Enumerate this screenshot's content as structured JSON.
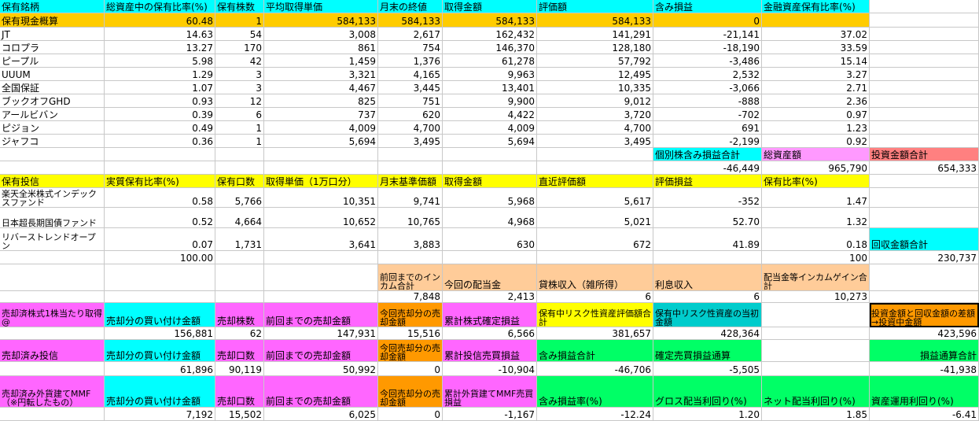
{
  "colors": {
    "cyan": "#00ffff",
    "yellow": "#ffff00",
    "orange": "#ff9900",
    "gold": "#ffcc00",
    "pink": "#ff66ff",
    "peach": "#ffcc99",
    "green": "#00ff66",
    "teal": "#00cccc",
    "lavender": "#ff99ff",
    "salmon": "#ff8080",
    "white": "#ffffff"
  },
  "cells": [
    {
      "r": 0,
      "c": 0,
      "t": "保有銘柄",
      "bg": "cyan",
      "a": "l"
    },
    {
      "r": 0,
      "c": 1,
      "t": "総資産中の保有比率(%)",
      "bg": "cyan",
      "a": "l"
    },
    {
      "r": 0,
      "c": 2,
      "t": "保有株数",
      "bg": "cyan",
      "a": "l"
    },
    {
      "r": 0,
      "c": 3,
      "t": "平均取得単価",
      "bg": "cyan",
      "a": "l"
    },
    {
      "r": 0,
      "c": 4,
      "t": "月末の終値",
      "bg": "cyan",
      "a": "l"
    },
    {
      "r": 0,
      "c": 5,
      "t": "取得金額",
      "bg": "cyan",
      "a": "l"
    },
    {
      "r": 0,
      "c": 6,
      "t": "評価額",
      "bg": "cyan",
      "a": "l"
    },
    {
      "r": 0,
      "c": 7,
      "t": "含み損益",
      "bg": "cyan",
      "a": "l"
    },
    {
      "r": 0,
      "c": 8,
      "t": "金融資産保有比率(%)",
      "bg": "cyan",
      "a": "l"
    },
    {
      "r": 1,
      "c": 0,
      "t": "保有現金概算",
      "bg": "gold",
      "a": "l"
    },
    {
      "r": 1,
      "c": 1,
      "t": "60.48",
      "bg": "gold",
      "a": "r"
    },
    {
      "r": 1,
      "c": 2,
      "t": "1",
      "bg": "gold",
      "a": "r"
    },
    {
      "r": 1,
      "c": 3,
      "t": "584,133",
      "bg": "gold",
      "a": "r"
    },
    {
      "r": 1,
      "c": 4,
      "t": "584,133",
      "bg": "gold",
      "a": "r"
    },
    {
      "r": 1,
      "c": 5,
      "t": "584,133",
      "bg": "gold",
      "a": "r"
    },
    {
      "r": 1,
      "c": 6,
      "t": "584,133",
      "bg": "gold",
      "a": "r"
    },
    {
      "r": 1,
      "c": 7,
      "t": "0",
      "bg": "gold",
      "a": "r"
    },
    {
      "r": 1,
      "c": 8,
      "t": "",
      "bg": "gold",
      "a": "r"
    },
    {
      "r": 2,
      "c": 0,
      "t": "JT",
      "a": "l"
    },
    {
      "r": 2,
      "c": 1,
      "t": "14.63",
      "a": "r"
    },
    {
      "r": 2,
      "c": 2,
      "t": "54",
      "a": "r"
    },
    {
      "r": 2,
      "c": 3,
      "t": "3,008",
      "a": "r"
    },
    {
      "r": 2,
      "c": 4,
      "t": "2,617",
      "a": "r"
    },
    {
      "r": 2,
      "c": 5,
      "t": "162,432",
      "a": "r"
    },
    {
      "r": 2,
      "c": 6,
      "t": "141,291",
      "a": "r"
    },
    {
      "r": 2,
      "c": 7,
      "t": "-21,141",
      "a": "r"
    },
    {
      "r": 2,
      "c": 8,
      "t": "37.02",
      "a": "r"
    },
    {
      "r": 3,
      "c": 0,
      "t": "コロプラ",
      "a": "l"
    },
    {
      "r": 3,
      "c": 1,
      "t": "13.27",
      "a": "r"
    },
    {
      "r": 3,
      "c": 2,
      "t": "170",
      "a": "r"
    },
    {
      "r": 3,
      "c": 3,
      "t": "861",
      "a": "r"
    },
    {
      "r": 3,
      "c": 4,
      "t": "754",
      "a": "r"
    },
    {
      "r": 3,
      "c": 5,
      "t": "146,370",
      "a": "r"
    },
    {
      "r": 3,
      "c": 6,
      "t": "128,180",
      "a": "r"
    },
    {
      "r": 3,
      "c": 7,
      "t": "-18,190",
      "a": "r"
    },
    {
      "r": 3,
      "c": 8,
      "t": "33.59",
      "a": "r"
    },
    {
      "r": 4,
      "c": 0,
      "t": "ピープル",
      "a": "l"
    },
    {
      "r": 4,
      "c": 1,
      "t": "5.98",
      "a": "r"
    },
    {
      "r": 4,
      "c": 2,
      "t": "42",
      "a": "r"
    },
    {
      "r": 4,
      "c": 3,
      "t": "1,459",
      "a": "r"
    },
    {
      "r": 4,
      "c": 4,
      "t": "1,376",
      "a": "r"
    },
    {
      "r": 4,
      "c": 5,
      "t": "61,278",
      "a": "r"
    },
    {
      "r": 4,
      "c": 6,
      "t": "57,792",
      "a": "r"
    },
    {
      "r": 4,
      "c": 7,
      "t": "-3,486",
      "a": "r"
    },
    {
      "r": 4,
      "c": 8,
      "t": "15.14",
      "a": "r"
    },
    {
      "r": 5,
      "c": 0,
      "t": "UUUM",
      "a": "l"
    },
    {
      "r": 5,
      "c": 1,
      "t": "1.29",
      "a": "r"
    },
    {
      "r": 5,
      "c": 2,
      "t": "3",
      "a": "r"
    },
    {
      "r": 5,
      "c": 3,
      "t": "3,321",
      "a": "r"
    },
    {
      "r": 5,
      "c": 4,
      "t": "4,165",
      "a": "r"
    },
    {
      "r": 5,
      "c": 5,
      "t": "9,963",
      "a": "r"
    },
    {
      "r": 5,
      "c": 6,
      "t": "12,495",
      "a": "r"
    },
    {
      "r": 5,
      "c": 7,
      "t": "2,532",
      "a": "r"
    },
    {
      "r": 5,
      "c": 8,
      "t": "3.27",
      "a": "r"
    },
    {
      "r": 6,
      "c": 0,
      "t": "全国保証",
      "a": "l"
    },
    {
      "r": 6,
      "c": 1,
      "t": "1.07",
      "a": "r"
    },
    {
      "r": 6,
      "c": 2,
      "t": "3",
      "a": "r"
    },
    {
      "r": 6,
      "c": 3,
      "t": "4,467",
      "a": "r"
    },
    {
      "r": 6,
      "c": 4,
      "t": "3,445",
      "a": "r"
    },
    {
      "r": 6,
      "c": 5,
      "t": "13,401",
      "a": "r"
    },
    {
      "r": 6,
      "c": 6,
      "t": "10,335",
      "a": "r"
    },
    {
      "r": 6,
      "c": 7,
      "t": "-3,066",
      "a": "r"
    },
    {
      "r": 6,
      "c": 8,
      "t": "2.71",
      "a": "r"
    },
    {
      "r": 7,
      "c": 0,
      "t": "ブックオフGHD",
      "a": "l"
    },
    {
      "r": 7,
      "c": 1,
      "t": "0.93",
      "a": "r"
    },
    {
      "r": 7,
      "c": 2,
      "t": "12",
      "a": "r"
    },
    {
      "r": 7,
      "c": 3,
      "t": "825",
      "a": "r"
    },
    {
      "r": 7,
      "c": 4,
      "t": "751",
      "a": "r"
    },
    {
      "r": 7,
      "c": 5,
      "t": "9,900",
      "a": "r"
    },
    {
      "r": 7,
      "c": 6,
      "t": "9,012",
      "a": "r"
    },
    {
      "r": 7,
      "c": 7,
      "t": "-888",
      "a": "r"
    },
    {
      "r": 7,
      "c": 8,
      "t": "2.36",
      "a": "r"
    },
    {
      "r": 8,
      "c": 0,
      "t": "アールビバン",
      "a": "l"
    },
    {
      "r": 8,
      "c": 1,
      "t": "0.39",
      "a": "r"
    },
    {
      "r": 8,
      "c": 2,
      "t": "6",
      "a": "r"
    },
    {
      "r": 8,
      "c": 3,
      "t": "737",
      "a": "r"
    },
    {
      "r": 8,
      "c": 4,
      "t": "620",
      "a": "r"
    },
    {
      "r": 8,
      "c": 5,
      "t": "4,422",
      "a": "r"
    },
    {
      "r": 8,
      "c": 6,
      "t": "3,720",
      "a": "r"
    },
    {
      "r": 8,
      "c": 7,
      "t": "-702",
      "a": "r"
    },
    {
      "r": 8,
      "c": 8,
      "t": "0.97",
      "a": "r"
    },
    {
      "r": 9,
      "c": 0,
      "t": "ピジョン",
      "a": "l"
    },
    {
      "r": 9,
      "c": 1,
      "t": "0.49",
      "a": "r"
    },
    {
      "r": 9,
      "c": 2,
      "t": "1",
      "a": "r"
    },
    {
      "r": 9,
      "c": 3,
      "t": "4,009",
      "a": "r"
    },
    {
      "r": 9,
      "c": 4,
      "t": "4,700",
      "a": "r"
    },
    {
      "r": 9,
      "c": 5,
      "t": "4,009",
      "a": "r"
    },
    {
      "r": 9,
      "c": 6,
      "t": "4,700",
      "a": "r"
    },
    {
      "r": 9,
      "c": 7,
      "t": "691",
      "a": "r"
    },
    {
      "r": 9,
      "c": 8,
      "t": "1.23",
      "a": "r"
    },
    {
      "r": 10,
      "c": 0,
      "t": "ジャフコ",
      "a": "l"
    },
    {
      "r": 10,
      "c": 1,
      "t": "0.36",
      "a": "r"
    },
    {
      "r": 10,
      "c": 2,
      "t": "1",
      "a": "r"
    },
    {
      "r": 10,
      "c": 3,
      "t": "5,694",
      "a": "r"
    },
    {
      "r": 10,
      "c": 4,
      "t": "3,495",
      "a": "r"
    },
    {
      "r": 10,
      "c": 5,
      "t": "5,694",
      "a": "r"
    },
    {
      "r": 10,
      "c": 6,
      "t": "3,495",
      "a": "r"
    },
    {
      "r": 10,
      "c": 7,
      "t": "-2,199",
      "a": "r"
    },
    {
      "r": 10,
      "c": 8,
      "t": "0.92",
      "a": "r"
    },
    {
      "r": 11,
      "c": 7,
      "t": "個別株含み損益合計",
      "bg": "cyan",
      "a": "l"
    },
    {
      "r": 11,
      "c": 8,
      "t": "総資産額",
      "bg": "lavender",
      "a": "l"
    },
    {
      "r": 11,
      "c": 9,
      "t": "投資金額合計",
      "bg": "salmon",
      "a": "l"
    },
    {
      "r": 12,
      "c": 7,
      "t": "-46,449",
      "a": "r"
    },
    {
      "r": 12,
      "c": 8,
      "t": "965,790",
      "a": "r"
    },
    {
      "r": 12,
      "c": 9,
      "t": "654,333",
      "a": "r"
    },
    {
      "r": 13,
      "c": 0,
      "t": "保有投信",
      "bg": "yellow",
      "a": "l"
    },
    {
      "r": 13,
      "c": 1,
      "t": "実質保有比率(%)",
      "bg": "yellow",
      "a": "l"
    },
    {
      "r": 13,
      "c": 2,
      "t": "保有口数",
      "bg": "yellow",
      "a": "l"
    },
    {
      "r": 13,
      "c": 3,
      "t": "取得単価（1万口分）",
      "bg": "yellow",
      "a": "l"
    },
    {
      "r": 13,
      "c": 4,
      "t": "月末基準価額",
      "bg": "yellow",
      "a": "l"
    },
    {
      "r": 13,
      "c": 5,
      "t": "取得金額",
      "bg": "yellow",
      "a": "l"
    },
    {
      "r": 13,
      "c": 6,
      "t": "直近評価額",
      "bg": "yellow",
      "a": "l"
    },
    {
      "r": 13,
      "c": 7,
      "t": "評価損益",
      "bg": "yellow",
      "a": "l"
    },
    {
      "r": 13,
      "c": 8,
      "t": "保有比率(%)",
      "bg": "yellow",
      "a": "l"
    },
    {
      "r": 14,
      "c": 0,
      "t": "楽天全米株式インデックスファンド",
      "a": "l",
      "w": 1
    },
    {
      "r": 14,
      "c": 1,
      "t": "0.58",
      "a": "r"
    },
    {
      "r": 14,
      "c": 2,
      "t": "5,766",
      "a": "r"
    },
    {
      "r": 14,
      "c": 3,
      "t": "10,351",
      "a": "r"
    },
    {
      "r": 14,
      "c": 4,
      "t": "9,741",
      "a": "r"
    },
    {
      "r": 14,
      "c": 5,
      "t": "5,968",
      "a": "r"
    },
    {
      "r": 14,
      "c": 6,
      "t": "5,617",
      "a": "r"
    },
    {
      "r": 14,
      "c": 7,
      "t": "-352",
      "a": "r"
    },
    {
      "r": 14,
      "c": 8,
      "t": "1.47",
      "a": "r"
    },
    {
      "r": 15,
      "c": 0,
      "t": "日本超長期国債ファンド",
      "a": "l",
      "w": 1
    },
    {
      "r": 15,
      "c": 1,
      "t": "0.52",
      "a": "r"
    },
    {
      "r": 15,
      "c": 2,
      "t": "4,664",
      "a": "r"
    },
    {
      "r": 15,
      "c": 3,
      "t": "10,652",
      "a": "r"
    },
    {
      "r": 15,
      "c": 4,
      "t": "10,765",
      "a": "r"
    },
    {
      "r": 15,
      "c": 5,
      "t": "4,968",
      "a": "r"
    },
    {
      "r": 15,
      "c": 6,
      "t": "5,021",
      "a": "r"
    },
    {
      "r": 15,
      "c": 7,
      "t": "52.70",
      "a": "r"
    },
    {
      "r": 15,
      "c": 8,
      "t": "1.32",
      "a": "r"
    },
    {
      "r": 16,
      "c": 0,
      "t": "リバーストレンドオープン",
      "a": "l",
      "w": 1
    },
    {
      "r": 16,
      "c": 1,
      "t": "0.07",
      "a": "r"
    },
    {
      "r": 16,
      "c": 2,
      "t": "1,731",
      "a": "r"
    },
    {
      "r": 16,
      "c": 3,
      "t": "3,641",
      "a": "r"
    },
    {
      "r": 16,
      "c": 4,
      "t": "3,883",
      "a": "r"
    },
    {
      "r": 16,
      "c": 5,
      "t": "630",
      "a": "r"
    },
    {
      "r": 16,
      "c": 6,
      "t": "672",
      "a": "r"
    },
    {
      "r": 16,
      "c": 7,
      "t": "41.89",
      "a": "r"
    },
    {
      "r": 16,
      "c": 8,
      "t": "0.18",
      "a": "r"
    },
    {
      "r": 16,
      "c": 9,
      "t": "回収金額合計",
      "bg": "cyan",
      "a": "l"
    },
    {
      "r": 17,
      "c": 1,
      "t": "100.00",
      "a": "r"
    },
    {
      "r": 17,
      "c": 8,
      "t": "100",
      "a": "r"
    },
    {
      "r": 17,
      "c": 9,
      "t": "230,737",
      "a": "r"
    },
    {
      "r": 18,
      "c": 4,
      "t": "前回までのインカム合計",
      "bg": "peach",
      "a": "l",
      "w": 1
    },
    {
      "r": 18,
      "c": 5,
      "t": "今回の配当金",
      "bg": "peach",
      "a": "l"
    },
    {
      "r": 18,
      "c": 6,
      "t": "貸株収入（雑所得）",
      "bg": "peach",
      "a": "l"
    },
    {
      "r": 18,
      "c": 7,
      "t": "利息収入",
      "bg": "peach",
      "a": "l"
    },
    {
      "r": 18,
      "c": 8,
      "t": "配当金等インカムゲイン合計",
      "bg": "peach",
      "a": "r",
      "w": 1
    },
    {
      "r": 19,
      "c": 4,
      "t": "7,848",
      "a": "r"
    },
    {
      "r": 19,
      "c": 5,
      "t": "2,413",
      "a": "r"
    },
    {
      "r": 19,
      "c": 6,
      "t": "6",
      "a": "r"
    },
    {
      "r": 19,
      "c": 7,
      "t": "6",
      "a": "r"
    },
    {
      "r": 19,
      "c": 8,
      "t": "10,273",
      "a": "r"
    },
    {
      "r": 20,
      "c": 0,
      "t": "売却済株式1株当たり取得@",
      "bg": "pink",
      "a": "l",
      "w": 1
    },
    {
      "r": 20,
      "c": 1,
      "t": "売却分の買い付け金額",
      "bg": "cyan",
      "a": "l"
    },
    {
      "r": 20,
      "c": 2,
      "t": "売却株数",
      "bg": "pink",
      "a": "l"
    },
    {
      "r": 20,
      "c": 3,
      "t": "前回までの売却金額",
      "bg": "pink",
      "a": "l"
    },
    {
      "r": 20,
      "c": 4,
      "t": "今回売却分の売却金額",
      "bg": "orange",
      "a": "l",
      "w": 1
    },
    {
      "r": 20,
      "c": 5,
      "t": "累計株式確定損益",
      "bg": "pink",
      "a": "l"
    },
    {
      "r": 20,
      "c": 6,
      "t": "保有中リスク性資産評価額合計",
      "bg": "yellow",
      "a": "l",
      "w": 1
    },
    {
      "r": 20,
      "c": 7,
      "t": "保有中リスク性資産の当初金額",
      "bg": "teal",
      "a": "l",
      "w": 1
    },
    {
      "r": 20,
      "c": 9,
      "t": "投資金額と回収金額の差額→投資中金額",
      "bg": "orange",
      "a": "l",
      "w": 1,
      "sel": 1
    },
    {
      "r": 21,
      "c": 1,
      "t": "156,881",
      "a": "r"
    },
    {
      "r": 21,
      "c": 2,
      "t": "62",
      "a": "r"
    },
    {
      "r": 21,
      "c": 3,
      "t": "147,931",
      "a": "r"
    },
    {
      "r": 21,
      "c": 4,
      "t": "15,516",
      "a": "r"
    },
    {
      "r": 21,
      "c": 5,
      "t": "6,566",
      "a": "r"
    },
    {
      "r": 21,
      "c": 6,
      "t": "381,657",
      "a": "r"
    },
    {
      "r": 21,
      "c": 7,
      "t": "428,364",
      "a": "r"
    },
    {
      "r": 21,
      "c": 9,
      "t": "423,596",
      "a": "r"
    },
    {
      "r": 22,
      "c": 0,
      "t": "売却済み投信",
      "bg": "pink",
      "a": "l"
    },
    {
      "r": 22,
      "c": 1,
      "t": "売却分の買い付け金額",
      "bg": "cyan",
      "a": "l"
    },
    {
      "r": 22,
      "c": 2,
      "t": "売却口数",
      "bg": "pink",
      "a": "l"
    },
    {
      "r": 22,
      "c": 3,
      "t": "前回までの売却金額",
      "bg": "pink",
      "a": "l"
    },
    {
      "r": 22,
      "c": 4,
      "t": "今回売却分の売却金額",
      "bg": "orange",
      "a": "l",
      "w": 1
    },
    {
      "r": 22,
      "c": 5,
      "t": "累計投信売買損益",
      "bg": "pink",
      "a": "l"
    },
    {
      "r": 22,
      "c": 6,
      "t": "含み損益合計",
      "bg": "green",
      "a": "l"
    },
    {
      "r": 22,
      "c": 7,
      "t": "確定売買損益通算",
      "bg": "green",
      "a": "l"
    },
    {
      "r": 22,
      "c": 9,
      "t": "損益通算合計",
      "bg": "green",
      "a": "r"
    },
    {
      "r": 23,
      "c": 1,
      "t": "61,896",
      "a": "r"
    },
    {
      "r": 23,
      "c": 2,
      "t": "90,119",
      "a": "r"
    },
    {
      "r": 23,
      "c": 3,
      "t": "50,992",
      "a": "r"
    },
    {
      "r": 23,
      "c": 4,
      "t": "0",
      "a": "r"
    },
    {
      "r": 23,
      "c": 5,
      "t": "-10,904",
      "a": "r"
    },
    {
      "r": 23,
      "c": 6,
      "t": "-46,706",
      "a": "r"
    },
    {
      "r": 23,
      "c": 7,
      "t": "-5,505",
      "a": "r"
    },
    {
      "r": 23,
      "c": 9,
      "t": "-41,938",
      "a": "r"
    },
    {
      "r": 24,
      "c": 0,
      "t": "売却済み外貨建てMMF（※円転したもの）",
      "bg": "pink",
      "a": "l",
      "w": 1
    },
    {
      "r": 24,
      "c": 1,
      "t": "売却分の買い付け金額",
      "bg": "cyan",
      "a": "l"
    },
    {
      "r": 24,
      "c": 2,
      "t": "売却口数",
      "bg": "pink",
      "a": "l"
    },
    {
      "r": 24,
      "c": 3,
      "t": "前回までの売却金額",
      "bg": "pink",
      "a": "l"
    },
    {
      "r": 24,
      "c": 4,
      "t": "今回売却分の売却金額",
      "bg": "orange",
      "a": "l",
      "w": 1
    },
    {
      "r": 24,
      "c": 5,
      "t": "累計外貨建てMMF売買損益",
      "bg": "pink",
      "a": "l",
      "w": 1
    },
    {
      "r": 24,
      "c": 6,
      "t": "含み損益率(%)",
      "bg": "green",
      "a": "l"
    },
    {
      "r": 24,
      "c": 7,
      "t": "グロス配当利回り(%)",
      "bg": "green",
      "a": "l"
    },
    {
      "r": 24,
      "c": 8,
      "t": "ネット配当利回り(%)",
      "bg": "green",
      "a": "l"
    },
    {
      "r": 24,
      "c": 9,
      "t": "資産運用利回り(%)",
      "bg": "green",
      "a": "l"
    },
    {
      "r": 25,
      "c": 1,
      "t": "7,192",
      "a": "r"
    },
    {
      "r": 25,
      "c": 2,
      "t": "15,502",
      "a": "r"
    },
    {
      "r": 25,
      "c": 3,
      "t": "6,025",
      "a": "r"
    },
    {
      "r": 25,
      "c": 4,
      "t": "0",
      "a": "r"
    },
    {
      "r": 25,
      "c": 5,
      "t": "-1,167",
      "a": "r"
    },
    {
      "r": 25,
      "c": 6,
      "t": "-12.24",
      "a": "r"
    },
    {
      "r": 25,
      "c": 7,
      "t": "1.20",
      "a": "r"
    },
    {
      "r": 25,
      "c": 8,
      "t": "1.85",
      "a": "r"
    },
    {
      "r": 25,
      "c": 9,
      "t": "-6.41",
      "a": "r"
    }
  ]
}
